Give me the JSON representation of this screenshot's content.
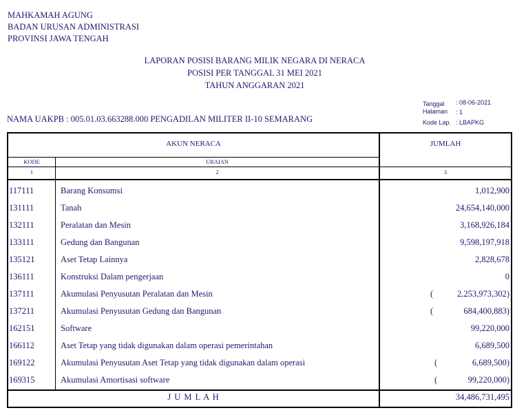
{
  "header": {
    "org_lines": [
      "MAHKAMAH AGUNG",
      "BADAN URUSAN ADMINISTRASI",
      "PROVINSI JAWA TENGAH"
    ],
    "title_lines": [
      "LAPORAN POSISI BARANG MILIK NEGARA DI NERACA",
      "POSISI PER TANGGAL 31 MEI 2021",
      "TAHUN ANGGARAN  2021"
    ],
    "uakpb": "NAMA UAKPB  :  005.01.03.663288.000   PENGADILAN MILITER II-10 SEMARANG",
    "meta": {
      "tanggal_label": "Tanggal",
      "tanggal_value": ": 08-06-2021",
      "halaman_label": "Halaman",
      "halaman_value": ":        1",
      "kode_lap_label": "Kode Lap.",
      "kode_lap_value": ": LBAPKG"
    }
  },
  "table": {
    "header_akun": "AKUN NERACA",
    "header_jumlah": "JUMLAH",
    "header_kode": "KODE",
    "header_uraian": "URAIAN",
    "colnum_1": "1",
    "colnum_2": "2",
    "colnum_3": "3",
    "rows": [
      {
        "kode": "117111",
        "uraian": "Barang Konsumsi",
        "paren": "",
        "jumlah": "1,012,900"
      },
      {
        "kode": "131111",
        "uraian": "Tanah",
        "paren": "",
        "jumlah": "24,654,140,000"
      },
      {
        "kode": "132111",
        "uraian": "Peralatan dan Mesin",
        "paren": "",
        "jumlah": "3,168,926,184"
      },
      {
        "kode": "133111",
        "uraian": "Gedung dan Bangunan",
        "paren": "",
        "jumlah": "9,598,197,918"
      },
      {
        "kode": "135121",
        "uraian": "Aset Tetap Lainnya",
        "paren": "",
        "jumlah": "2,828,678"
      },
      {
        "kode": "136111",
        "uraian": "Konstruksi Dalam pengerjaan",
        "paren": "",
        "jumlah": "0"
      },
      {
        "kode": "137111",
        "uraian": "Akumulasi Penyusutan Peralatan dan Mesin",
        "paren": "(",
        "jumlah": "2,253,973,302)"
      },
      {
        "kode": "137211",
        "uraian": "Akumulasi Penyusutan Gedung dan Bangunan",
        "paren": "(",
        "jumlah": "684,400,883)"
      },
      {
        "kode": "162151",
        "uraian": "Software",
        "paren": "",
        "jumlah": "99,220,000"
      },
      {
        "kode": "166112",
        "uraian": "Aset Tetap yang tidak digunakan dalam operasi pemerintahan",
        "paren": "",
        "jumlah": "6,689,500"
      },
      {
        "kode": "169122",
        "uraian": "Akumulasi Penyusutan Aset Tetap yang tidak digunakan dalam operasi",
        "paren": "(",
        "jumlah": "6,689,500)"
      },
      {
        "kode": "169315",
        "uraian": "Akumulasi Amortisasi software",
        "paren": "(",
        "jumlah": "99,220,000)"
      }
    ],
    "total_label": "J   U   M   L   A   H",
    "total_value": "34,486,731,495"
  }
}
